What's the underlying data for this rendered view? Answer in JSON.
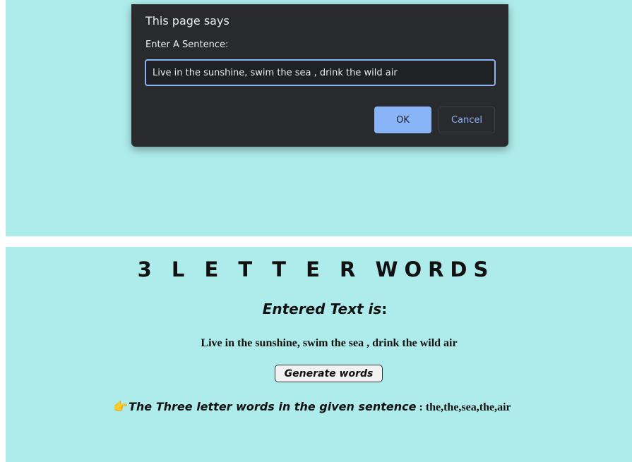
{
  "dialog": {
    "title": "This page says",
    "label": "Enter A Sentence:",
    "input_value": "Live in the sunshine, swim the sea , drink the wild air",
    "ok_label": "OK",
    "cancel_label": "Cancel"
  },
  "page": {
    "title": "3 L E T T E R WORDS",
    "entered_heading": "Entered Text is",
    "entered_colon": ":",
    "entered_text": "Live in the sunshine, swim the sea , drink the wild air",
    "generate_label": "Generate words",
    "pointer_icon": "👉",
    "result_label": "The Three letter words in the given sentence",
    "result_separator": " : ",
    "result_value": "the,the,sea,the,air"
  },
  "colors": {
    "background": "#aeeceb",
    "dialog_bg": "#292a2d",
    "accent": "#8ab4f8"
  }
}
